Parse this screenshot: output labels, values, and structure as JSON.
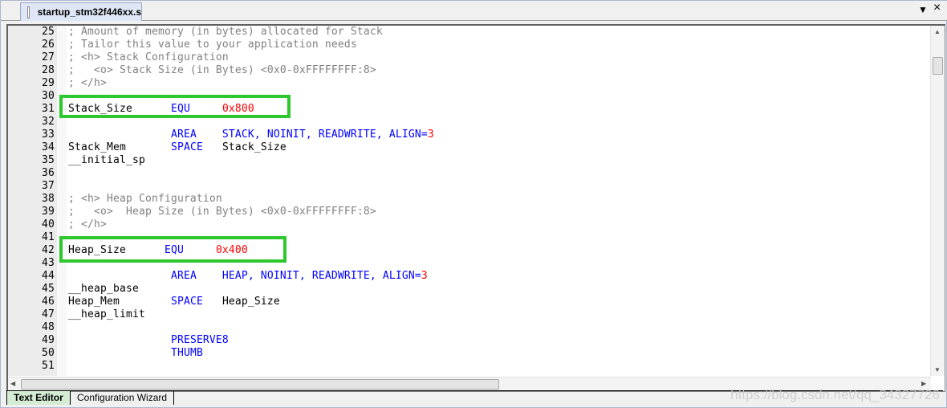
{
  "file_tab": {
    "title": "startup_stm32f446xx.s",
    "icon": "document-icon"
  },
  "window_controls": {
    "dropdown": "▼",
    "close": "×"
  },
  "lines": [
    {
      "num": "25",
      "segs": [
        {
          "t": "; Amount of memory (in bytes) allocated for Stack",
          "c": "c"
        }
      ]
    },
    {
      "num": "26",
      "segs": [
        {
          "t": "; Tailor this value to your application needs",
          "c": "c"
        }
      ]
    },
    {
      "num": "27",
      "segs": [
        {
          "t": "; <h> Stack Configuration",
          "c": "c"
        }
      ]
    },
    {
      "num": "28",
      "segs": [
        {
          "t": ";   <o> Stack Size (in Bytes) <0x0-0xFFFFFFFF:8>",
          "c": "c"
        }
      ]
    },
    {
      "num": "29",
      "segs": [
        {
          "t": "; </h>",
          "c": "c"
        }
      ]
    },
    {
      "num": "30",
      "segs": []
    },
    {
      "num": "31",
      "segs": [
        {
          "t": "Stack_Size      ",
          "c": "d"
        },
        {
          "t": "EQU     ",
          "c": "k"
        },
        {
          "t": "0x800",
          "c": "n"
        }
      ]
    },
    {
      "num": "32",
      "segs": []
    },
    {
      "num": "33",
      "segs": [
        {
          "t": "                ",
          "c": "d"
        },
        {
          "t": "AREA    STACK, NOINIT, READWRITE, ALIGN=",
          "c": "k"
        },
        {
          "t": "3",
          "c": "n"
        }
      ]
    },
    {
      "num": "34",
      "segs": [
        {
          "t": "Stack_Mem       ",
          "c": "d"
        },
        {
          "t": "SPACE   ",
          "c": "k"
        },
        {
          "t": "Stack_Size",
          "c": "d"
        }
      ]
    },
    {
      "num": "35",
      "segs": [
        {
          "t": "__initial_sp",
          "c": "d"
        }
      ]
    },
    {
      "num": "36",
      "segs": []
    },
    {
      "num": "37",
      "segs": []
    },
    {
      "num": "38",
      "segs": [
        {
          "t": "; <h> Heap Configuration",
          "c": "c"
        }
      ]
    },
    {
      "num": "39",
      "segs": [
        {
          "t": ";   <o>  Heap Size (in Bytes) <0x0-0xFFFFFFFF:8>",
          "c": "c"
        }
      ]
    },
    {
      "num": "40",
      "segs": [
        {
          "t": "; </h>",
          "c": "c"
        }
      ]
    },
    {
      "num": "41",
      "segs": []
    },
    {
      "num": "42",
      "segs": [
        {
          "t": "Heap_Size      ",
          "c": "d"
        },
        {
          "t": "EQU     ",
          "c": "k"
        },
        {
          "t": "0x400",
          "c": "n"
        }
      ]
    },
    {
      "num": "43",
      "segs": []
    },
    {
      "num": "44",
      "segs": [
        {
          "t": "                ",
          "c": "d"
        },
        {
          "t": "AREA    HEAP, NOINIT, READWRITE, ALIGN=",
          "c": "k"
        },
        {
          "t": "3",
          "c": "n"
        }
      ]
    },
    {
      "num": "45",
      "segs": [
        {
          "t": "__heap_base",
          "c": "d"
        }
      ]
    },
    {
      "num": "46",
      "segs": [
        {
          "t": "Heap_Mem        ",
          "c": "d"
        },
        {
          "t": "SPACE   ",
          "c": "k"
        },
        {
          "t": "Heap_Size",
          "c": "d"
        }
      ]
    },
    {
      "num": "47",
      "segs": [
        {
          "t": "__heap_limit",
          "c": "d"
        }
      ]
    },
    {
      "num": "48",
      "segs": []
    },
    {
      "num": "49",
      "segs": [
        {
          "t": "                ",
          "c": "d"
        },
        {
          "t": "PRESERVE8",
          "c": "k"
        }
      ]
    },
    {
      "num": "50",
      "segs": [
        {
          "t": "                ",
          "c": "d"
        },
        {
          "t": "THUMB",
          "c": "k"
        }
      ]
    },
    {
      "num": "51",
      "segs": []
    }
  ],
  "highlight_color": "#2ec82e",
  "bottom_tabs": [
    {
      "label": "Text Editor",
      "active": true
    },
    {
      "label": "Configuration Wizard",
      "active": false
    }
  ],
  "watermark": "https://blog.csdn.net/qq_34327726"
}
